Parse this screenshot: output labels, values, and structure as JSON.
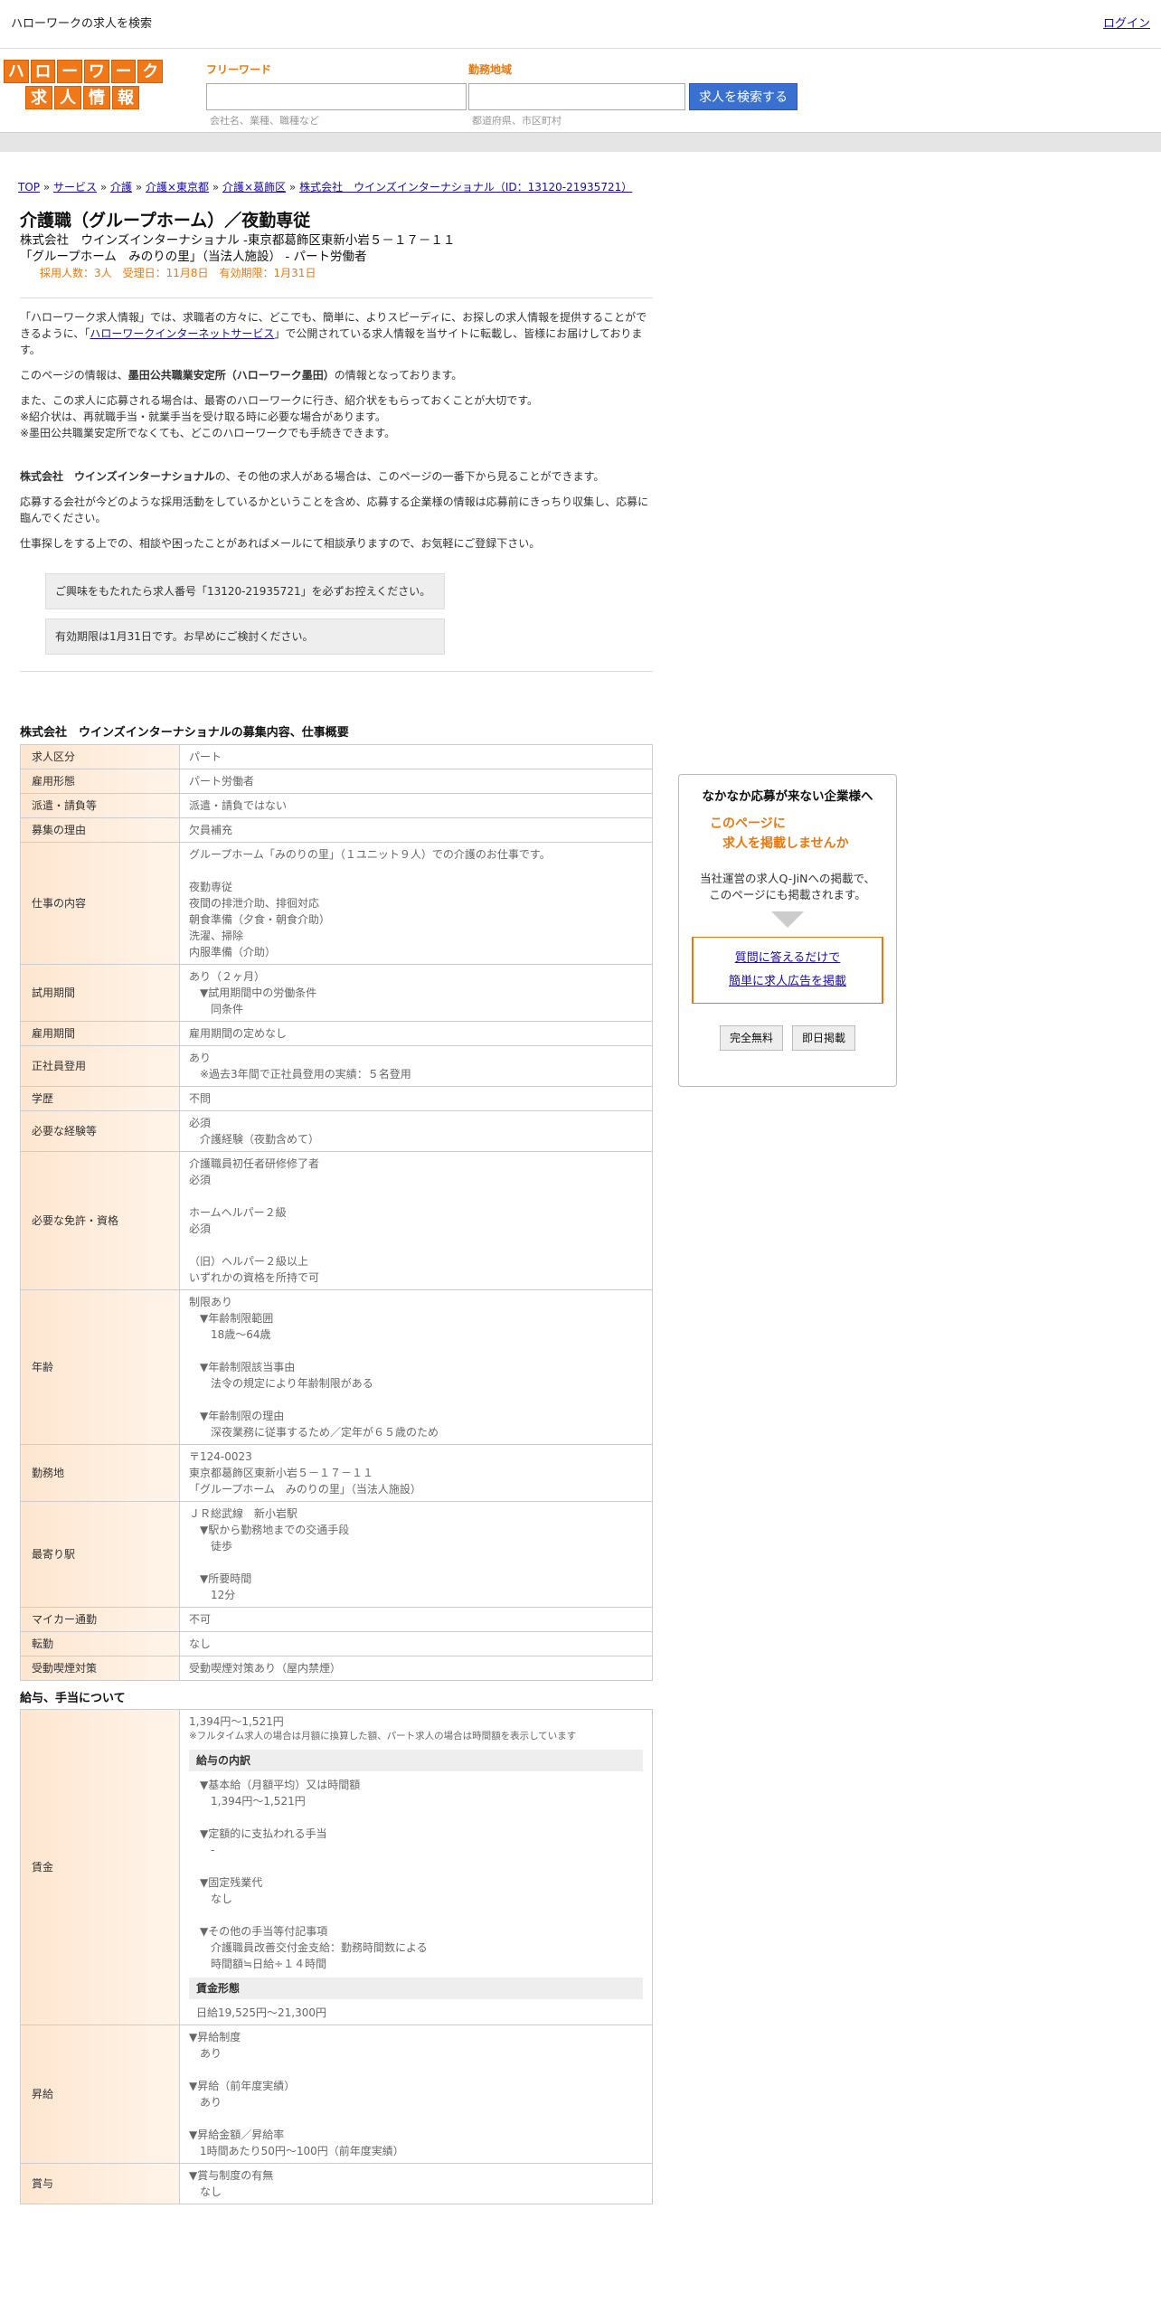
{
  "header": {
    "title": "ハローワークの求人を検索",
    "login": "ログイン"
  },
  "logo": {
    "row1": [
      "ハ",
      "ロ",
      "ー",
      "ワ",
      "ー",
      "ク"
    ],
    "row2": [
      "求",
      "人",
      "情",
      "報"
    ]
  },
  "search": {
    "keyword_label": "フリーワード",
    "keyword_hint": "会社名、業種、職種など",
    "area_label": "勤務地域",
    "area_hint": "都道府県、市区町村",
    "button": "求人を検索する"
  },
  "breadcrumb": [
    "TOP",
    "サービス",
    "介護",
    "介護×東京都",
    "介護×葛飾区",
    "株式会社　ウインズインターナショナル（ID：13120-21935721）"
  ],
  "job": {
    "title": "介護職（グループホーム）／夜勤専従",
    "company_line": "株式会社　ウインズインターナショナル -東京都葛飾区東新小岩５－１７－１１",
    "facility_line": "「グループホーム　みのりの里」（当法人施設） - パート労働者",
    "meta": "採用人数：3人　受理日：11月8日　有効期限：1月31日"
  },
  "intro": {
    "p1a": "「ハローワーク求人情報」では、求職者の方々に、どこでも、簡単に、よりスピーディに、お探しの求人情報を提供することができるように、「",
    "p1link": "ハローワークインターネットサービス",
    "p1b": "」で公開されている求人情報を当サイトに転載し、皆様にお届けしております。",
    "p2a": "このページの情報は、",
    "p2b": "墨田公共職業安定所（ハローワーク墨田）",
    "p2c": "の情報となっております。",
    "p3": "また、この求人に応募される場合は、最寄のハローワークに行き、紹介状をもらっておくことが大切です。\n※紹介状は、再就職手当・就業手当を受け取る時に必要な場合があります。\n※墨田公共職業安定所でなくても、どこのハローワークでも手続きできます。",
    "p4a": "株式会社　ウインズインターナショナル",
    "p4b": "の、その他の求人がある場合は、このページの一番下から見ることができます。",
    "p5": "応募する会社が今どのような採用活動をしているかということを含め、応募する企業様の情報は応募前にきっちり収集し、応募に臨んでください。",
    "p6": "仕事探しをする上での、相談や困ったことがあればメールにて相談承りますので、お気軽にご登録下さい。",
    "notice1": "ご興味をもたれたら求人番号「13120-21935721」を必ずお控えください。",
    "notice2": "有効期限は1月31日です。お早めにご検討ください。"
  },
  "overview": {
    "title": "株式会社　ウインズインターナショナルの募集内容、仕事概要",
    "rows": [
      {
        "k": "求人区分",
        "v": "パート"
      },
      {
        "k": "雇用形態",
        "v": "パート労働者"
      },
      {
        "k": "派遣・請負等",
        "v": "派遣・請負ではない"
      },
      {
        "k": "募集の理由",
        "v": "欠員補充"
      },
      {
        "k": "仕事の内容",
        "v": "グループホーム「みのりの里」（１ユニット９人）での介護のお仕事です。\n\n夜勤専従\n夜間の排泄介助、排徊対応\n朝食準備（夕食・朝食介助）\n洗濯、掃除\n内服準備（介助）"
      },
      {
        "k": "試用期間",
        "v": "あり（２ヶ月）\n　▼試用期間中の労働条件\n　　同条件"
      },
      {
        "k": "雇用期間",
        "v": "雇用期間の定めなし"
      },
      {
        "k": "正社員登用",
        "v": "あり\n　※過去3年間で正社員登用の実績：５名登用"
      },
      {
        "k": "学歴",
        "v": "不問"
      },
      {
        "k": "必要な経験等",
        "v": "必須\n　介護経験（夜勤含めて）"
      },
      {
        "k": "必要な免許・資格",
        "v": "介護職員初任者研修修了者\n必須\n\nホームヘルパー２級\n必須\n\n（旧）ヘルパー２級以上\nいずれかの資格を所持で可"
      },
      {
        "k": "年齢",
        "v": "制限あり\n　▼年齢制限範囲\n　　18歳〜64歳\n\n　▼年齢制限該当事由\n　　法令の規定により年齢制限がある\n\n　▼年齢制限の理由\n　　深夜業務に従事するため／定年が６５歳のため"
      },
      {
        "k": "勤務地",
        "v": "〒124-0023\n東京都葛飾区東新小岩５－１７－１１\n「グループホーム　みのりの里」（当法人施設）"
      },
      {
        "k": "最寄り駅",
        "v": "ＪＲ総武線　新小岩駅\n　▼駅から勤務地までの交通手段\n　　徒歩\n\n　▼所要時間\n　　12分"
      },
      {
        "k": "マイカー通勤",
        "v": "不可"
      },
      {
        "k": "転勤",
        "v": "なし"
      },
      {
        "k": "受動喫煙対策",
        "v": "受動喫煙対策あり（屋内禁煙）"
      }
    ]
  },
  "salary": {
    "title": "給与、手当について",
    "wage_label": "賃金",
    "wage": "1,394円〜1,521円",
    "wage_note": "※フルタイム求人の場合は月額に換算した額、パート求人の場合は時間額を表示しています",
    "breakdown_title": "給与の内訳",
    "breakdown": "　▼基本給（月額平均）又は時間額\n　　1,394円〜1,521円\n\n　▼定額的に支払われる手当\n　　-\n\n　▼固定残業代\n　　なし\n\n　▼その他の手当等付記事項\n　　介護職員改善交付金支給：勤務時間数による\n　　時間額≒日給÷１４時間",
    "form_title": "賃金形態",
    "form": "日給19,525円〜21,300円",
    "raise_label": "昇給",
    "raise": "▼昇給制度\n　あり\n\n▼昇給（前年度実績）\n　あり\n\n▼昇給金額／昇給率\n　1時間あたり50円〜100円（前年度実績）",
    "bonus_label": "賞与",
    "bonus": "▼賞与制度の有無\n　なし"
  },
  "side": {
    "title": "なかなか応募が来ない企業様へ",
    "catch1": "このページに",
    "catch2": "　求人を掲載しませんか",
    "desc": "当社運営の求人Q-JiNへの掲載で、\nこのページにも掲載されます。",
    "link1": "質問に答えるだけで",
    "link2": "簡単に求人広告を掲載",
    "btn1": "完全無料",
    "btn2": "即日掲載"
  }
}
